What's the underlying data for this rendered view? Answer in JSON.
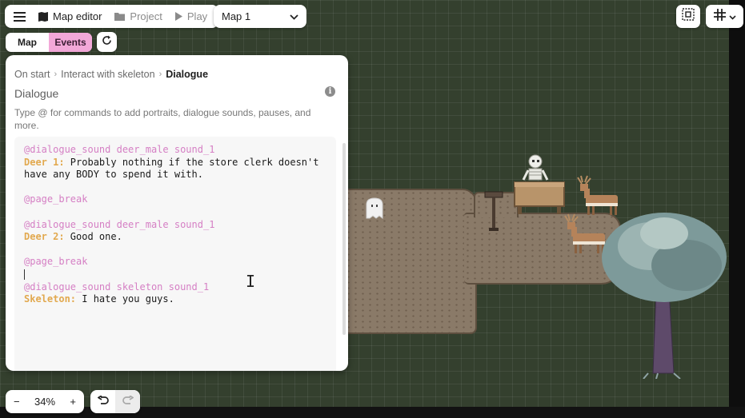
{
  "toolbar": {
    "menu_icon": "hamburger-menu-icon",
    "map_editor_label": "Map editor",
    "project_label": "Project",
    "play_label": "Play",
    "map_select_value": "Map 1"
  },
  "view_toggle": {
    "map_label": "Map",
    "events_label": "Events"
  },
  "panel": {
    "breadcrumb": [
      "On start",
      "Interact with skeleton",
      "Dialogue"
    ],
    "title": "Dialogue",
    "hint": "Type @ for commands to add portraits, dialogue sounds, pauses, and more.",
    "lines": [
      {
        "kind": "command",
        "text": "@dialogue_sound deer_male sound_1"
      },
      {
        "kind": "speech",
        "speaker": "Deer 1:",
        "text": " Probably nothing if the store clerk doesn't"
      },
      {
        "kind": "plain",
        "text": "have any BODY to spend it with."
      },
      {
        "kind": "blank",
        "text": ""
      },
      {
        "kind": "command",
        "text": "@page_break"
      },
      {
        "kind": "blank",
        "text": ""
      },
      {
        "kind": "command",
        "text": "@dialogue_sound deer_male sound_1"
      },
      {
        "kind": "speech",
        "speaker": "Deer 2:",
        "text": " Good one."
      },
      {
        "kind": "blank",
        "text": ""
      },
      {
        "kind": "command",
        "text": "@page_break"
      },
      {
        "kind": "caret",
        "text": ""
      },
      {
        "kind": "command",
        "text": "@dialogue_sound skeleton sound_1"
      },
      {
        "kind": "speech",
        "speaker": "Skeleton:",
        "text": " I hate you guys."
      }
    ]
  },
  "zoom": {
    "minus": "−",
    "value": "34%",
    "plus": "+"
  },
  "colors": {
    "accent_pink": "#f2a8d8",
    "command_pink": "#d57fc4",
    "speaker_orange": "#e2a94f",
    "map_background": "#34402e",
    "dirt": "#8a7a68"
  }
}
